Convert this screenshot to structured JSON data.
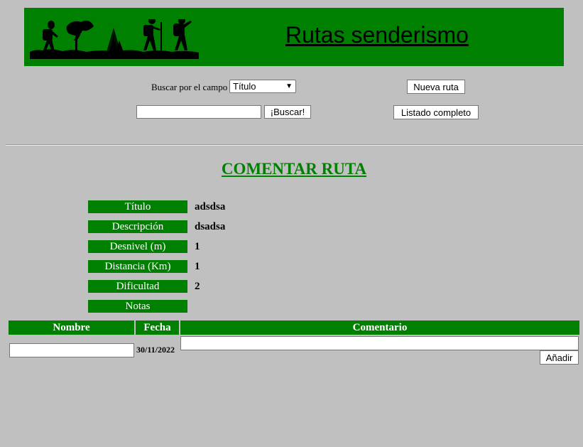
{
  "header": {
    "title": "Rutas senderismo",
    "banner_color": "#008000"
  },
  "search": {
    "label": "Buscar por el campo",
    "field_selected": "Título",
    "query_value": "",
    "button_label": "¡Buscar!"
  },
  "actions": {
    "new_route": "Nueva ruta",
    "full_list": "Listado completo"
  },
  "section_title": "COMENTAR RUTA",
  "route": [
    {
      "label": "Título",
      "value": "adsdsa"
    },
    {
      "label": "Descripción",
      "value": "dsadsa"
    },
    {
      "label": "Desnivel (m)",
      "value": "1"
    },
    {
      "label": "Distancia (Km)",
      "value": "1"
    },
    {
      "label": "Dificultad",
      "value": "2"
    },
    {
      "label": "Notas",
      "value": ""
    }
  ],
  "comments_table": {
    "headers": [
      "Nombre",
      "Fecha",
      "Comentario"
    ],
    "new_row": {
      "name_value": "",
      "date": "30/11/2022",
      "comment_value": ""
    },
    "add_button": "Añadir"
  }
}
